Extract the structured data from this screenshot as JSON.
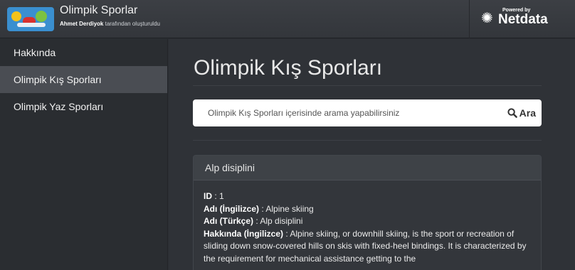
{
  "header": {
    "title": "Olimpik Sporlar",
    "author": "Ahmet Derdiyok",
    "subtitle_rest": "tarafından oluşturuldu",
    "powered_by": "Powered by",
    "brand": "Netdata"
  },
  "sidebar": {
    "items": [
      {
        "label": "Hakkında",
        "active": false
      },
      {
        "label": "Olimpik Kış Sporları",
        "active": true
      },
      {
        "label": "Olimpik Yaz Sporları",
        "active": false
      }
    ]
  },
  "main": {
    "title": "Olimpik Kış Sporları",
    "search": {
      "placeholder": "Olimpik Kış Sporları içerisinde arama yapabilirsiniz",
      "button_label": "Ara"
    },
    "panel": {
      "heading": "Alp disiplini",
      "id_label": "ID",
      "id_value": "1",
      "name_en_label": "Adı (İngilizce)",
      "name_en_value": "Alpine skiing",
      "name_tr_label": "Adı (Türkçe)",
      "name_tr_value": "Alp disiplini",
      "about_en_label": "Hakkında (İngilizce)",
      "about_en_value": "Alpine skiing, or downhill skiing, is the sport or recreation of sliding down snow-covered hills on skis with fixed-heel bindings. It is characterized by the requirement for mechanical assistance getting to the"
    }
  }
}
